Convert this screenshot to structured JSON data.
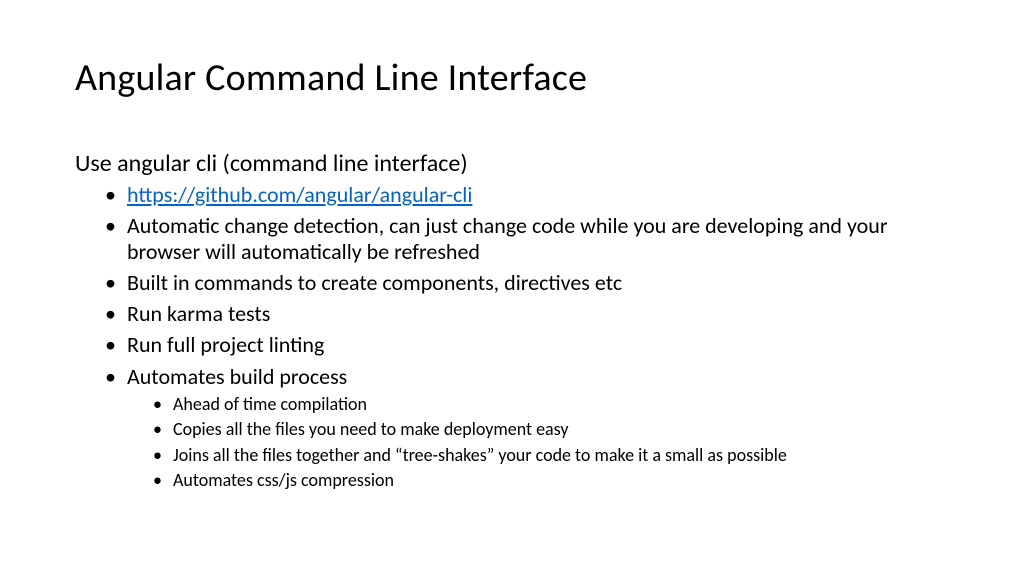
{
  "title": "Angular Command Line Interface",
  "subtitle": "Use angular cli (command line interface)",
  "link": {
    "text": "https://github.com/angular/angular-cli"
  },
  "bullets": {
    "b1": "Automatic change detection, can just change code while you are developing and your browser will automatically be refreshed",
    "b2": "Built in commands to create components, directives etc",
    "b3": "Run karma tests",
    "b4": "Run full project linting",
    "b5": "Automates build process"
  },
  "subbullets": {
    "s1": "Ahead of time compilation",
    "s2": "Copies all the files you need to make deployment easy",
    "s3": "Joins all the files together and “tree-shakes” your code to make it a small as possible",
    "s4": "Automates css/js compression"
  }
}
